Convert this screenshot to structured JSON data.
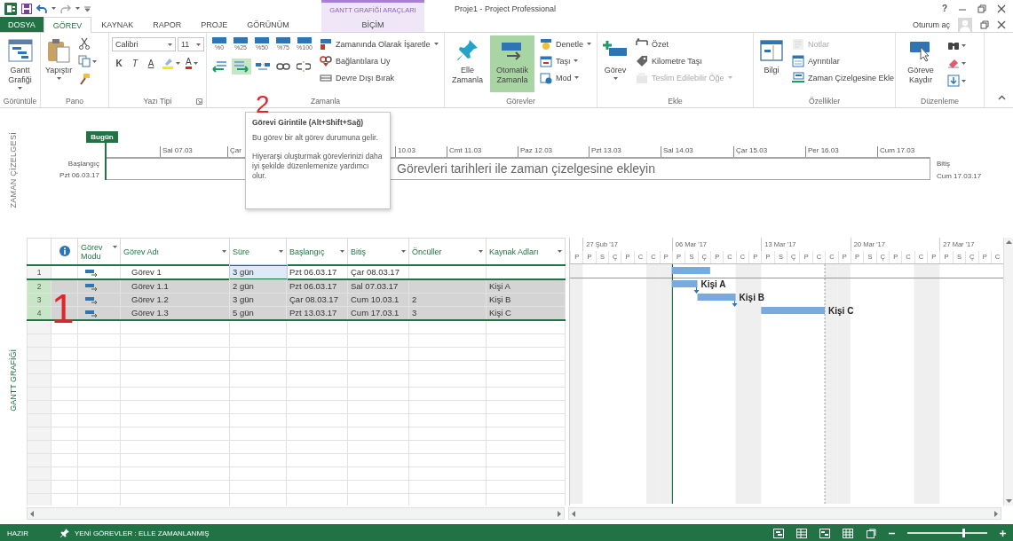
{
  "title_bar": {
    "context_group": "GANTT GRAFİĞİ ARAÇLARI",
    "title": "Proje1 - Project Professional",
    "help": "?"
  },
  "tabs": [
    {
      "label": "DOSYA",
      "kind": "file",
      "selected": false
    },
    {
      "label": "GÖREV",
      "kind": "normal",
      "selected": true
    },
    {
      "label": "KAYNAK",
      "kind": "normal",
      "selected": false
    },
    {
      "label": "RAPOR",
      "kind": "normal",
      "selected": false
    },
    {
      "label": "PROJE",
      "kind": "normal",
      "selected": false
    },
    {
      "label": "GÖRÜNÜM",
      "kind": "normal",
      "selected": false
    },
    {
      "label": "BİÇİM",
      "kind": "contextual",
      "selected": false
    }
  ],
  "account": {
    "label": "Oturum aç"
  },
  "ribbon": {
    "groups": [
      {
        "kind": "view",
        "label": "Görüntüle",
        "large": [
          {
            "text": "Gantt Grafiği",
            "dropdown": true
          }
        ]
      },
      {
        "kind": "clipboard",
        "label": "Pano",
        "large": [
          {
            "text": "Yapıştır",
            "dropdown": true
          }
        ]
      },
      {
        "kind": "font",
        "label": "Yazı Tipi",
        "font_name": "Calibri",
        "font_size": "11",
        "format_buttons": [
          {
            "text": "K",
            "kind": "bold"
          },
          {
            "text": "T",
            "kind": "italic"
          },
          {
            "text": "A",
            "kind": "underline"
          }
        ],
        "color_button": "A"
      },
      {
        "kind": "schedule",
        "label": "Zamanla",
        "percent_buttons": [
          "%0",
          "%25",
          "%50",
          "%75",
          "%100"
        ],
        "indent_buttons": [
          {
            "kind": "outdent",
            "hovered": false
          },
          {
            "kind": "indent",
            "hovered": true
          }
        ],
        "commands": [
          {
            "text": "Zamanında Olarak İşaretle",
            "dropdown": true,
            "disabled": false
          },
          {
            "text": "Bağlantılara Uy",
            "dropdown": false,
            "disabled": false
          },
          {
            "text": "Devre Dışı Bırak",
            "dropdown": false,
            "disabled": false
          }
        ]
      },
      {
        "kind": "tasks",
        "label": "Görevler",
        "large": [
          {
            "text": "Elle Zamanla",
            "dropdown": false,
            "selected": false
          },
          {
            "text": "Otomatik Zamanla",
            "dropdown": false,
            "selected": true
          }
        ],
        "commands": [
          {
            "text": "Denetle",
            "dropdown": true,
            "disabled": false
          },
          {
            "text": "Taşı",
            "dropdown": true,
            "disabled": false
          },
          {
            "text": "Mod",
            "dropdown": true,
            "disabled": false
          }
        ]
      },
      {
        "kind": "insert",
        "label": "Ekle",
        "large": [
          {
            "text": "Görev",
            "dropdown": true
          }
        ],
        "commands": [
          {
            "text": "Özet",
            "dropdown": false,
            "disabled": false
          },
          {
            "text": "Kilometre Taşı",
            "dropdown": false,
            "disabled": false
          },
          {
            "text": "Teslim Edilebilir Öğe",
            "dropdown": true,
            "disabled": true
          }
        ]
      },
      {
        "kind": "properties",
        "label": "Özellikler",
        "large": [
          {
            "text": "Bilgi",
            "dropdown": false
          }
        ],
        "commands": [
          {
            "text": "Notlar",
            "dropdown": false,
            "disabled": true
          },
          {
            "text": "Ayrıntılar",
            "dropdown": false,
            "disabled": false
          },
          {
            "text": "Zaman Çizelgesine Ekle",
            "dropdown": false,
            "disabled": false
          }
        ]
      },
      {
        "kind": "editing",
        "label": "Düzenleme",
        "large": [
          {
            "text": "Göreve Kaydır",
            "dropdown": false
          }
        ]
      }
    ]
  },
  "timeline": {
    "label": "ZAMAN ÇİZELGESİ",
    "today": "Bugün",
    "start_label": "Başlangıç",
    "start_date": "Pzt 06.03.17",
    "end_label": "Bitiş",
    "end_date": "Cum 17.03.17",
    "ticks": [
      "Sal 07.03",
      "Çar",
      "10.03",
      "Cmt 11.03",
      "Paz 12.03",
      "Pzt 13.03",
      "Sal 14.03",
      "Çar 15.03",
      "Per 16.03",
      "Cum 17.03"
    ],
    "placeholder": "Görevleri tarihleri ile zaman çizelgesine ekleyin"
  },
  "tooltip": {
    "title": "Görevi Girintile (Alt+Shift+Sağ)",
    "paragraphs": [
      "Bu görev bir alt görev durumuna gelir.",
      "Hiyerarşi oluşturmak görevlerinizi daha iyi şekilde düzenlemenize yardımcı olur."
    ]
  },
  "table": {
    "side_label": "GANTT GRAFİĞİ",
    "columns": [
      "Görev Modu",
      "Görev Adı",
      "Süre",
      "Başlangıç",
      "Bitiş",
      "Öncüller",
      "Kaynak Adları"
    ],
    "rows": [
      {
        "id": "1",
        "name": "Görev 1",
        "duration": "3 gün",
        "start": "Pzt 06.03.17",
        "finish": "Çar 08.03.17",
        "selected": false,
        "duration_focused": true
      },
      {
        "id": "2",
        "name": "Görev 1.1",
        "duration": "2 gün",
        "start": "Pzt 06.03.17",
        "finish": "Sal 07.03.17",
        "resources": "Kişi A",
        "bar_label": "Kişi A",
        "selected": true,
        "duration_focused": false
      },
      {
        "id": "3",
        "name": "Görev 1.2",
        "duration": "3 gün",
        "start": "Çar 08.03.17",
        "finish": "Cum 10.03.1",
        "predecessors": "2",
        "resources": "Kişi B",
        "bar_label": "Kişi B",
        "selected": true,
        "duration_focused": false
      },
      {
        "id": "4",
        "name": "Görev 1.3",
        "duration": "5 gün",
        "start": "Pzt 13.03.17",
        "finish": "Cum 17.03.1",
        "predecessors": "3",
        "resources": "Kişi C",
        "bar_label": "Kişi C",
        "selected": true,
        "duration_focused": false
      }
    ]
  },
  "gantt": {
    "weeks": [
      "27 Şub '17",
      "06 Mar '17",
      "13 Mar '17",
      "20 Mar '17",
      "27 Mar '17"
    ],
    "days": [
      "P",
      "P",
      "S",
      "Ç",
      "P",
      "C",
      "C",
      "P",
      "P",
      "S",
      "Ç",
      "P",
      "C",
      "C",
      "P",
      "P",
      "S",
      "Ç",
      "P",
      "C",
      "C",
      "P",
      "P",
      "S",
      "Ç",
      "P",
      "C",
      "C",
      "P",
      "P",
      "S",
      "Ç",
      "P",
      "C"
    ]
  },
  "status_bar": {
    "mode": "HAZIR",
    "new_tasks": "YENİ GÖREVLER : ELLE ZAMANLANMIŞ",
    "zoom": {
      "level": 0.7
    }
  },
  "annotations": [
    {
      "text": "2"
    },
    {
      "text": "1"
    }
  ]
}
